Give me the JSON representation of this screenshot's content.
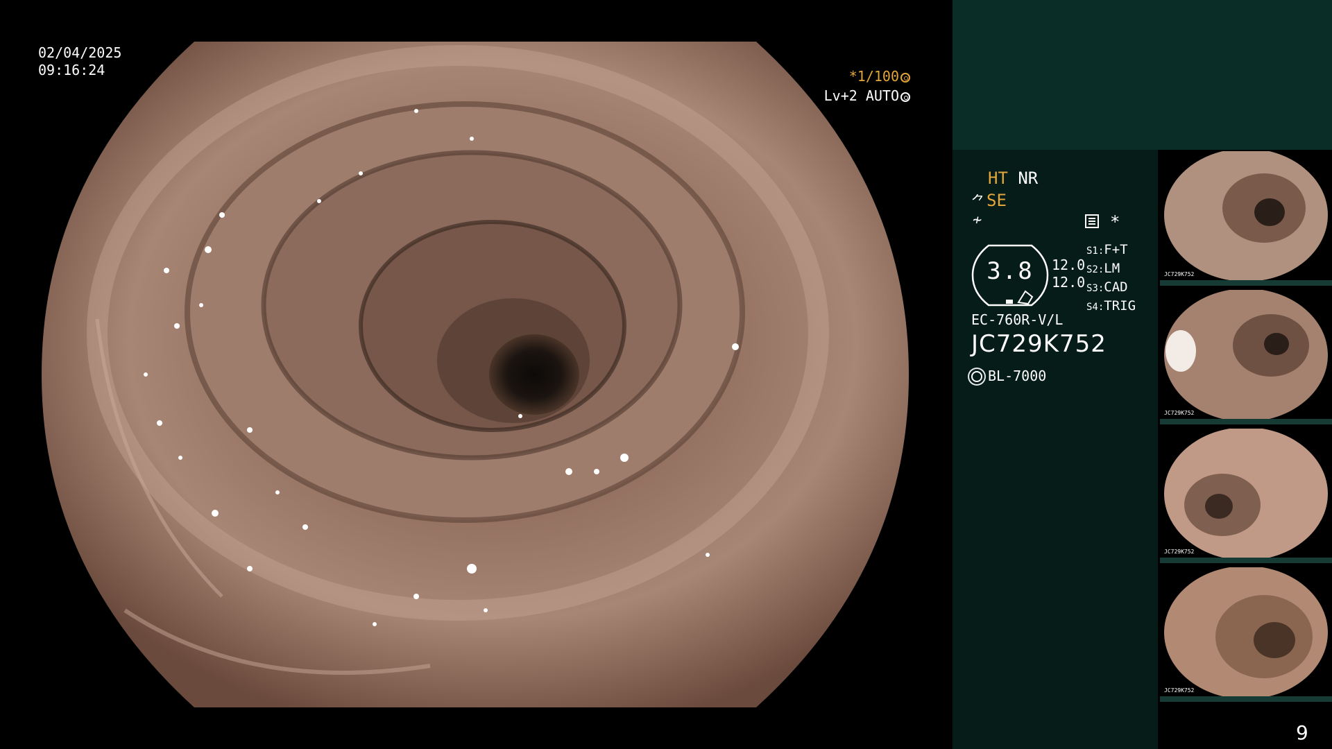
{
  "overlay": {
    "date": "02/04/2025",
    "time": "09:16:24",
    "shutter": "*1/100",
    "level": "Lv+2 AUTO"
  },
  "panel": {
    "ht": "HT",
    "nr": "NR",
    "se": "SE",
    "gauge_value": "3.8",
    "values": [
      "12.0",
      "12.0"
    ],
    "slots": [
      {
        "key": "S1:",
        "value": "F+T"
      },
      {
        "key": "S2:",
        "value": "LM"
      },
      {
        "key": "S3:",
        "value": "CAD"
      },
      {
        "key": "S4:",
        "value": "TRIG"
      }
    ],
    "model": "EC-760R-V/L",
    "serial": "JC729K752",
    "light_source": "BL-7000"
  },
  "thumbnails": [
    {
      "serial": "JC729K752"
    },
    {
      "serial": "JC729K752"
    },
    {
      "serial": "JC729K752"
    },
    {
      "serial": "JC729K752"
    }
  ],
  "page_number": "9",
  "colors": {
    "accent_orange": "#e2a63a",
    "panel_teal": "#0b2d28",
    "panel_dark": "#061c19"
  }
}
